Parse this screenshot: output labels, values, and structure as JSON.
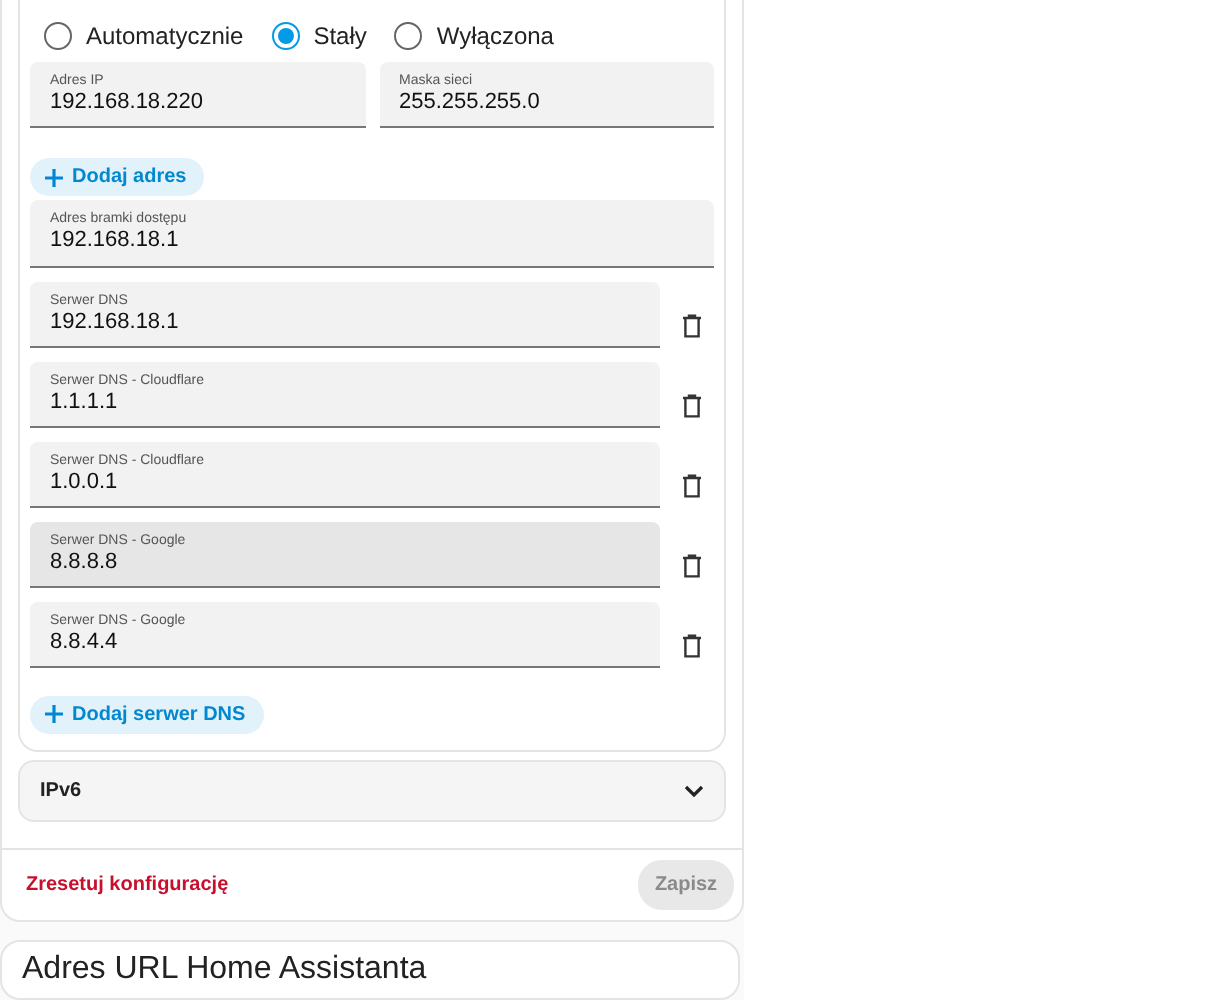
{
  "ipv4": {
    "modes": [
      {
        "label": "Automatycznie",
        "selected": false
      },
      {
        "label": "Stały",
        "selected": true
      },
      {
        "label": "Wyłączona",
        "selected": false
      }
    ],
    "addresses": [
      {
        "label": "Adres IP",
        "value": "192.168.18.220"
      },
      {
        "label": "Maska sieci",
        "value": "255.255.255.0"
      }
    ],
    "add_address": "Dodaj adres",
    "gateway": {
      "label": "Adres bramki dostępu",
      "value": "192.168.18.1"
    },
    "dns": [
      {
        "label": "Serwer DNS",
        "value": "192.168.18.1",
        "highlighted": false
      },
      {
        "label": "Serwer DNS - Cloudflare",
        "value": "1.1.1.1",
        "highlighted": false
      },
      {
        "label": "Serwer DNS - Cloudflare",
        "value": "1.0.0.1",
        "highlighted": false
      },
      {
        "label": "Serwer DNS - Google",
        "value": "8.8.8.8",
        "highlighted": true
      },
      {
        "label": "Serwer DNS - Google",
        "value": "8.8.4.4",
        "highlighted": false
      }
    ],
    "add_dns": "Dodaj serwer DNS"
  },
  "ipv6": {
    "title": "IPv6",
    "expanded": false
  },
  "footer": {
    "reset": "Zresetuj konfigurację",
    "save": {
      "label": "Zapisz",
      "disabled": true
    }
  },
  "next_card": {
    "title": "Adres URL Home Assistanta"
  }
}
